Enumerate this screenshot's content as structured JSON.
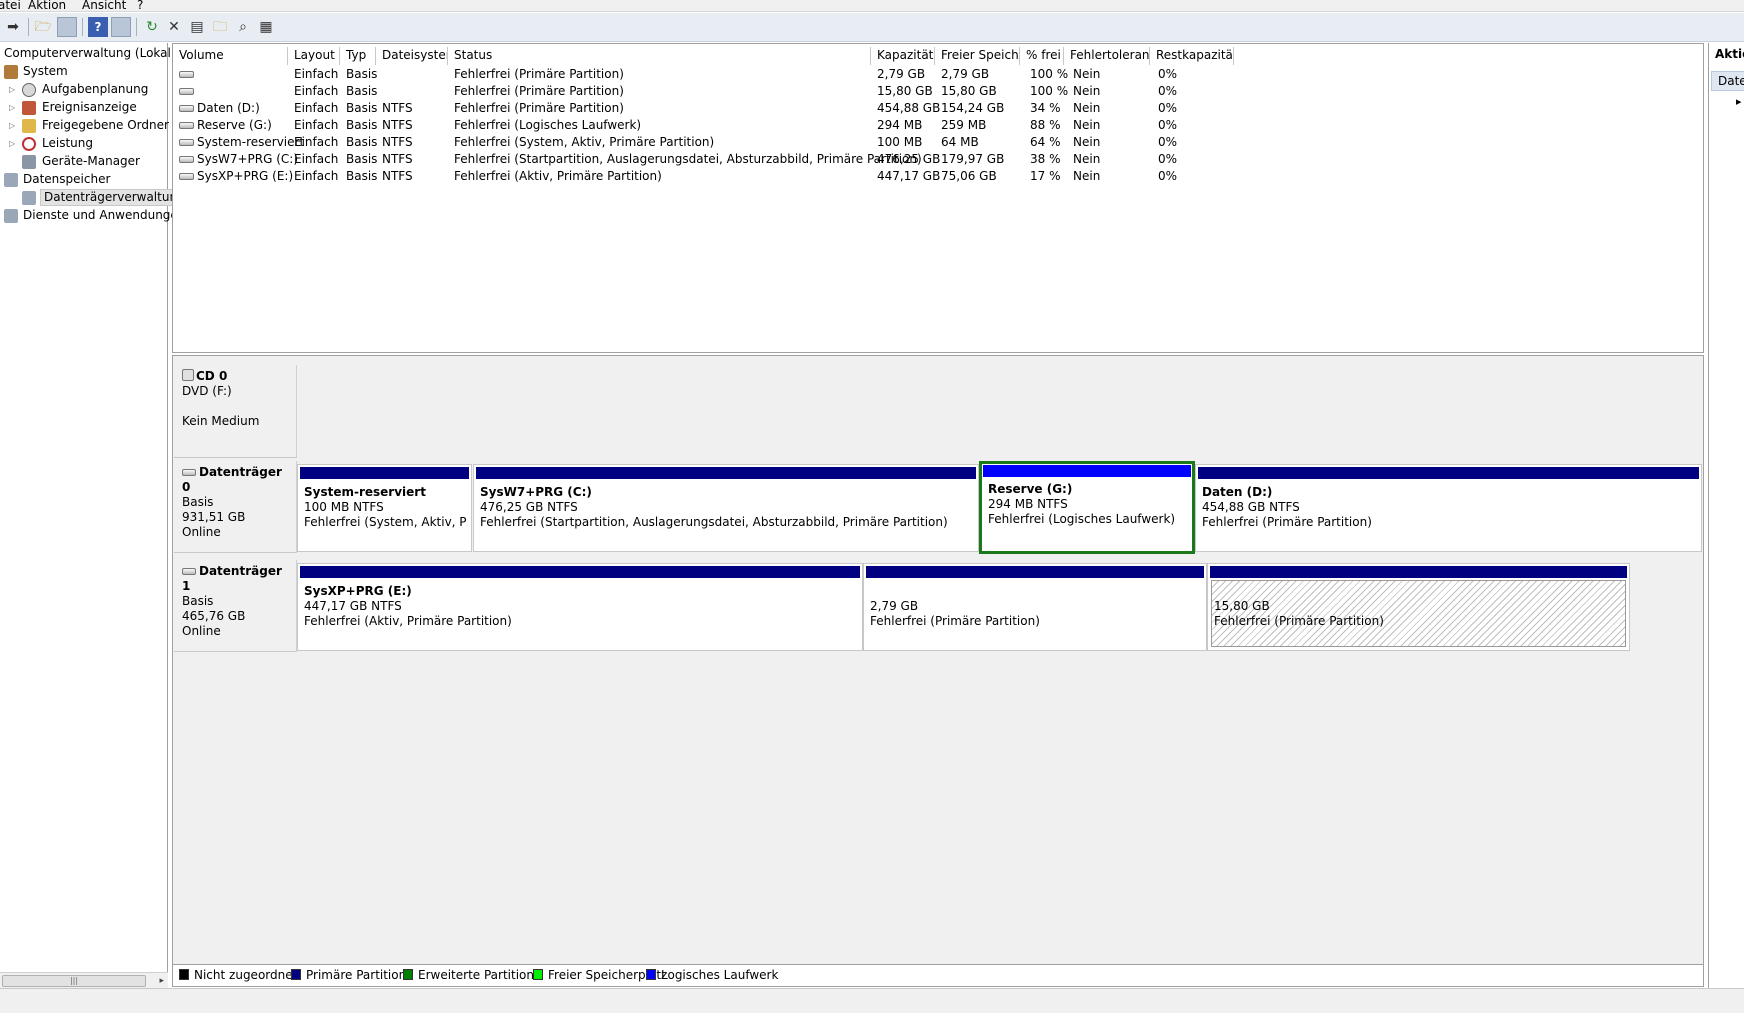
{
  "menu": {
    "items": [
      "atei",
      "Aktion",
      "Ansicht",
      "?"
    ]
  },
  "toolbar": {
    "icons": [
      "forward-arrow-icon",
      "up-folder-icon",
      "show-hide-tree-icon",
      "help-icon",
      "show-hide-action-icon",
      "refresh-icon",
      "delete-icon",
      "properties-icon",
      "open-icon",
      "search-icon",
      "export-icon"
    ]
  },
  "tree": {
    "root": "Computerverwaltung (Lokal)",
    "system": "System",
    "aufgabenplanung": "Aufgabenplanung",
    "ereignisanzeige": "Ereignisanzeige",
    "freigegebene": "Freigegebene Ordner",
    "leistung": "Leistung",
    "geraete": "Geräte-Manager",
    "datenspeicher": "Datenspeicher",
    "datentraegerverwaltung": "Datenträgerverwaltung",
    "dienste": "Dienste und Anwendungen"
  },
  "volumes": {
    "columns": [
      "Volume",
      "Layout",
      "Typ",
      "Dateisystem",
      "Status",
      "Kapazität",
      "Freier Speicher",
      "% frei",
      "Fehlertoleranz",
      "Restkapazität"
    ],
    "rows": [
      {
        "volume": "",
        "layout": "Einfach",
        "typ": "Basis",
        "fs": "",
        "status": "Fehlerfrei (Primäre Partition)",
        "kap": "2,79 GB",
        "frei": "2,79 GB",
        "pct": "100 %",
        "fehl": "Nein",
        "rest": "0%"
      },
      {
        "volume": "",
        "layout": "Einfach",
        "typ": "Basis",
        "fs": "",
        "status": "Fehlerfrei (Primäre Partition)",
        "kap": "15,80 GB",
        "frei": "15,80 GB",
        "pct": "100 %",
        "fehl": "Nein",
        "rest": "0%"
      },
      {
        "volume": "Daten (D:)",
        "layout": "Einfach",
        "typ": "Basis",
        "fs": "NTFS",
        "status": "Fehlerfrei (Primäre Partition)",
        "kap": "454,88 GB",
        "frei": "154,24 GB",
        "pct": "34 %",
        "fehl": "Nein",
        "rest": "0%"
      },
      {
        "volume": "Reserve (G:)",
        "layout": "Einfach",
        "typ": "Basis",
        "fs": "NTFS",
        "status": "Fehlerfrei (Logisches Laufwerk)",
        "kap": "294 MB",
        "frei": "259 MB",
        "pct": "88 %",
        "fehl": "Nein",
        "rest": "0%"
      },
      {
        "volume": "System-reserviert",
        "layout": "Einfach",
        "typ": "Basis",
        "fs": "NTFS",
        "status": "Fehlerfrei (System, Aktiv, Primäre Partition)",
        "kap": "100 MB",
        "frei": "64 MB",
        "pct": "64 %",
        "fehl": "Nein",
        "rest": "0%"
      },
      {
        "volume": "SysW7+PRG (C:)",
        "layout": "Einfach",
        "typ": "Basis",
        "fs": "NTFS",
        "status": "Fehlerfrei (Startpartition, Auslagerungsdatei, Absturzabbild, Primäre Partition)",
        "kap": "476,25 GB",
        "frei": "179,97 GB",
        "pct": "38 %",
        "fehl": "Nein",
        "rest": "0%"
      },
      {
        "volume": "SysXP+PRG (E:)",
        "layout": "Einfach",
        "typ": "Basis",
        "fs": "NTFS",
        "status": "Fehlerfrei (Aktiv, Primäre Partition)",
        "kap": "447,17 GB",
        "frei": "75,06 GB",
        "pct": "17 %",
        "fehl": "Nein",
        "rest": "0%"
      }
    ]
  },
  "disks": {
    "cd0": {
      "title": "CD 0",
      "drive": "DVD (F:)",
      "medium": "Kein Medium"
    },
    "disk0": {
      "title": "Datenträger 0",
      "type": "Basis",
      "size": "931,51 GB",
      "state": "Online",
      "parts": [
        {
          "name": "System-reserviert",
          "size": "100 MB NTFS",
          "status": "Fehlerfrei (System, Aktiv, Primäre Partition)"
        },
        {
          "name": "SysW7+PRG  (C:)",
          "size": "476,25 GB NTFS",
          "status": "Fehlerfrei (Startpartition, Auslagerungsdatei, Absturzabbild, Primäre Partition)"
        },
        {
          "name": "Reserve  (G:)",
          "size": "294 MB NTFS",
          "status": "Fehlerfrei (Logisches Laufwerk)"
        },
        {
          "name": "Daten  (D:)",
          "size": "454,88 GB NTFS",
          "status": "Fehlerfrei (Primäre Partition)"
        }
      ]
    },
    "disk1": {
      "title": "Datenträger 1",
      "type": "Basis",
      "size": "465,76 GB",
      "state": "Online",
      "parts": [
        {
          "name": "SysXP+PRG  (E:)",
          "size": "447,17 GB NTFS",
          "status": "Fehlerfrei (Aktiv, Primäre Partition)"
        },
        {
          "size": "2,79 GB",
          "status": "Fehlerfrei (Primäre Partition)"
        },
        {
          "size": "15,80 GB",
          "status": "Fehlerfrei (Primäre Partition)"
        }
      ]
    }
  },
  "legend": {
    "items": [
      {
        "label": "Nicht zugeordnet",
        "color": "#000000"
      },
      {
        "label": "Primäre Partition",
        "color": "#000080"
      },
      {
        "label": "Erweiterte Partition",
        "color": "#008000"
      },
      {
        "label": "Freier Speicherplatz",
        "color": "#00ee00"
      },
      {
        "label": "Logisches Laufwerk",
        "color": "#0000ff"
      }
    ]
  },
  "actions": {
    "header": "Aktionen",
    "sub": "Datenträgerverwaltung"
  }
}
